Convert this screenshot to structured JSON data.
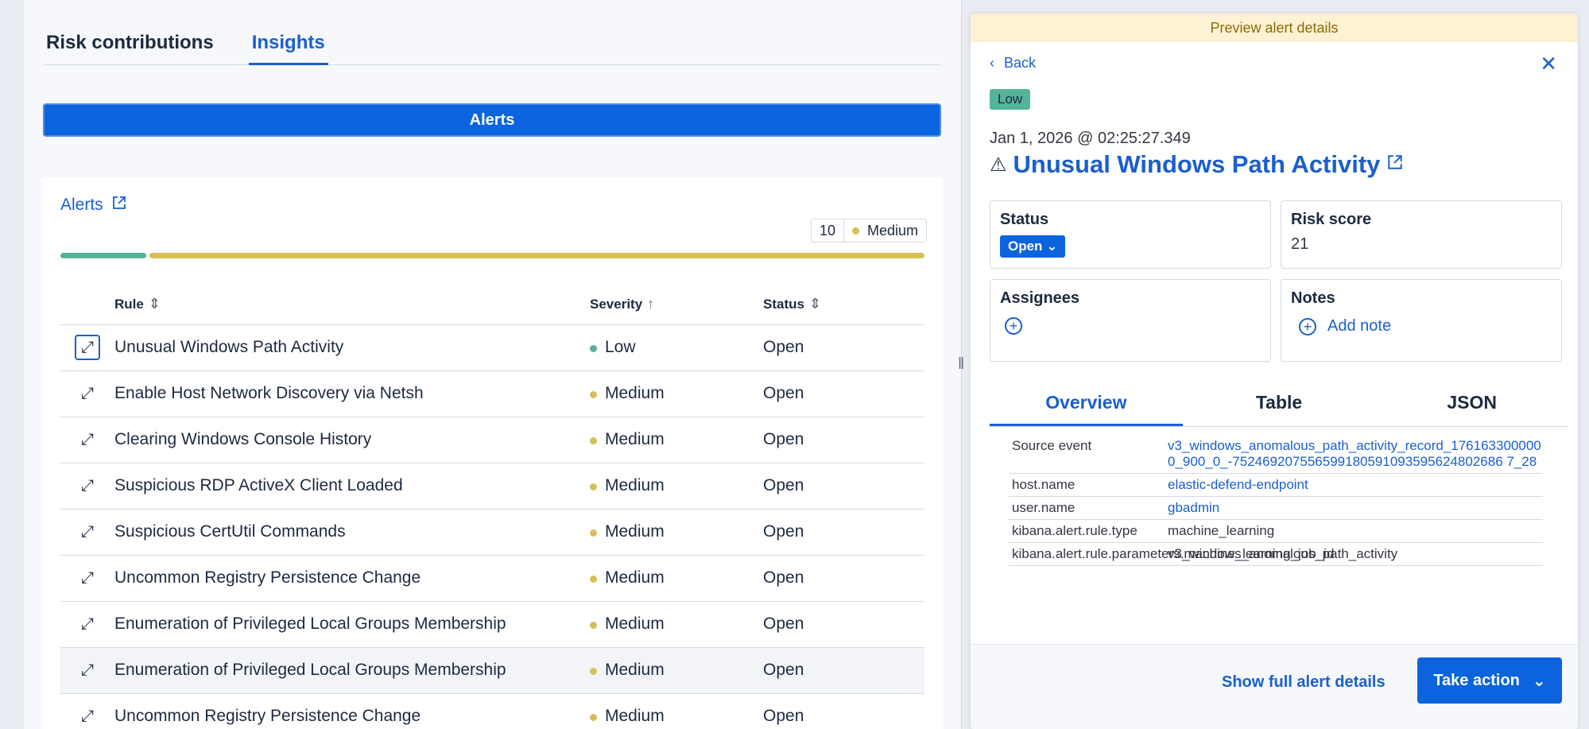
{
  "left": {
    "tabs": [
      {
        "label": "Risk contributions",
        "active": false
      },
      {
        "label": "Insights",
        "active": true
      }
    ],
    "alerts_button": "Alerts",
    "card": {
      "link_label": "Alerts",
      "count": "10",
      "severity_label": "Medium",
      "severity_distribution": {
        "low": 1,
        "medium": 9
      },
      "columns": {
        "rule": "Rule",
        "severity": "Severity",
        "status": "Status"
      },
      "rows": [
        {
          "rule": "Unusual Windows Path Activity",
          "severity": "Low",
          "status": "Open"
        },
        {
          "rule": "Enable Host Network Discovery via Netsh",
          "severity": "Medium",
          "status": "Open"
        },
        {
          "rule": "Clearing Windows Console History",
          "severity": "Medium",
          "status": "Open"
        },
        {
          "rule": "Suspicious RDP ActiveX Client Loaded",
          "severity": "Medium",
          "status": "Open"
        },
        {
          "rule": "Suspicious CertUtil Commands",
          "severity": "Medium",
          "status": "Open"
        },
        {
          "rule": "Uncommon Registry Persistence Change",
          "severity": "Medium",
          "status": "Open"
        },
        {
          "rule": "Enumeration of Privileged Local Groups Membership",
          "severity": "Medium",
          "status": "Open"
        },
        {
          "rule": "Enumeration of Privileged Local Groups Membership",
          "severity": "Medium",
          "status": "Open"
        },
        {
          "rule": "Uncommon Registry Persistence Change",
          "severity": "Medium",
          "status": "Open"
        }
      ]
    }
  },
  "preview": {
    "banner": "Preview alert details",
    "back_label": "Back",
    "severity_badge": "Low",
    "timestamp": "Jan 1, 2026 @ 02:25:27.349",
    "title": "Unusual Windows Path Activity",
    "status_label": "Status",
    "status_value": "Open",
    "risk_label": "Risk score",
    "risk_value": "21",
    "assignees_label": "Assignees",
    "notes_label": "Notes",
    "add_note_label": "Add note",
    "tabs": [
      "Overview",
      "Table",
      "JSON"
    ],
    "fields": [
      {
        "key": "Source event",
        "value": "v3_windows_anomalous_path_activity_record_1761633000000_900_0_-752469207556599180591093595624802686 7_28",
        "link": true
      },
      {
        "key": "host.name",
        "value": "elastic-defend-endpoint",
        "link": true
      },
      {
        "key": "user.name",
        "value": "gbadmin",
        "link": true
      },
      {
        "key": "kibana.alert.rule.type",
        "value": "machine_learning",
        "link": false
      },
      {
        "key": "kibana.alert.rule.parameters.machine_learning_job_id",
        "value": "v3_windows_anomalous_path_activity",
        "link": false
      }
    ],
    "show_full_label": "Show full alert details",
    "take_action_label": "Take action"
  },
  "colors": {
    "accent": "#0b64dd",
    "link": "#1a5fcd",
    "low": "#54b399",
    "medium": "#d6bf57"
  }
}
